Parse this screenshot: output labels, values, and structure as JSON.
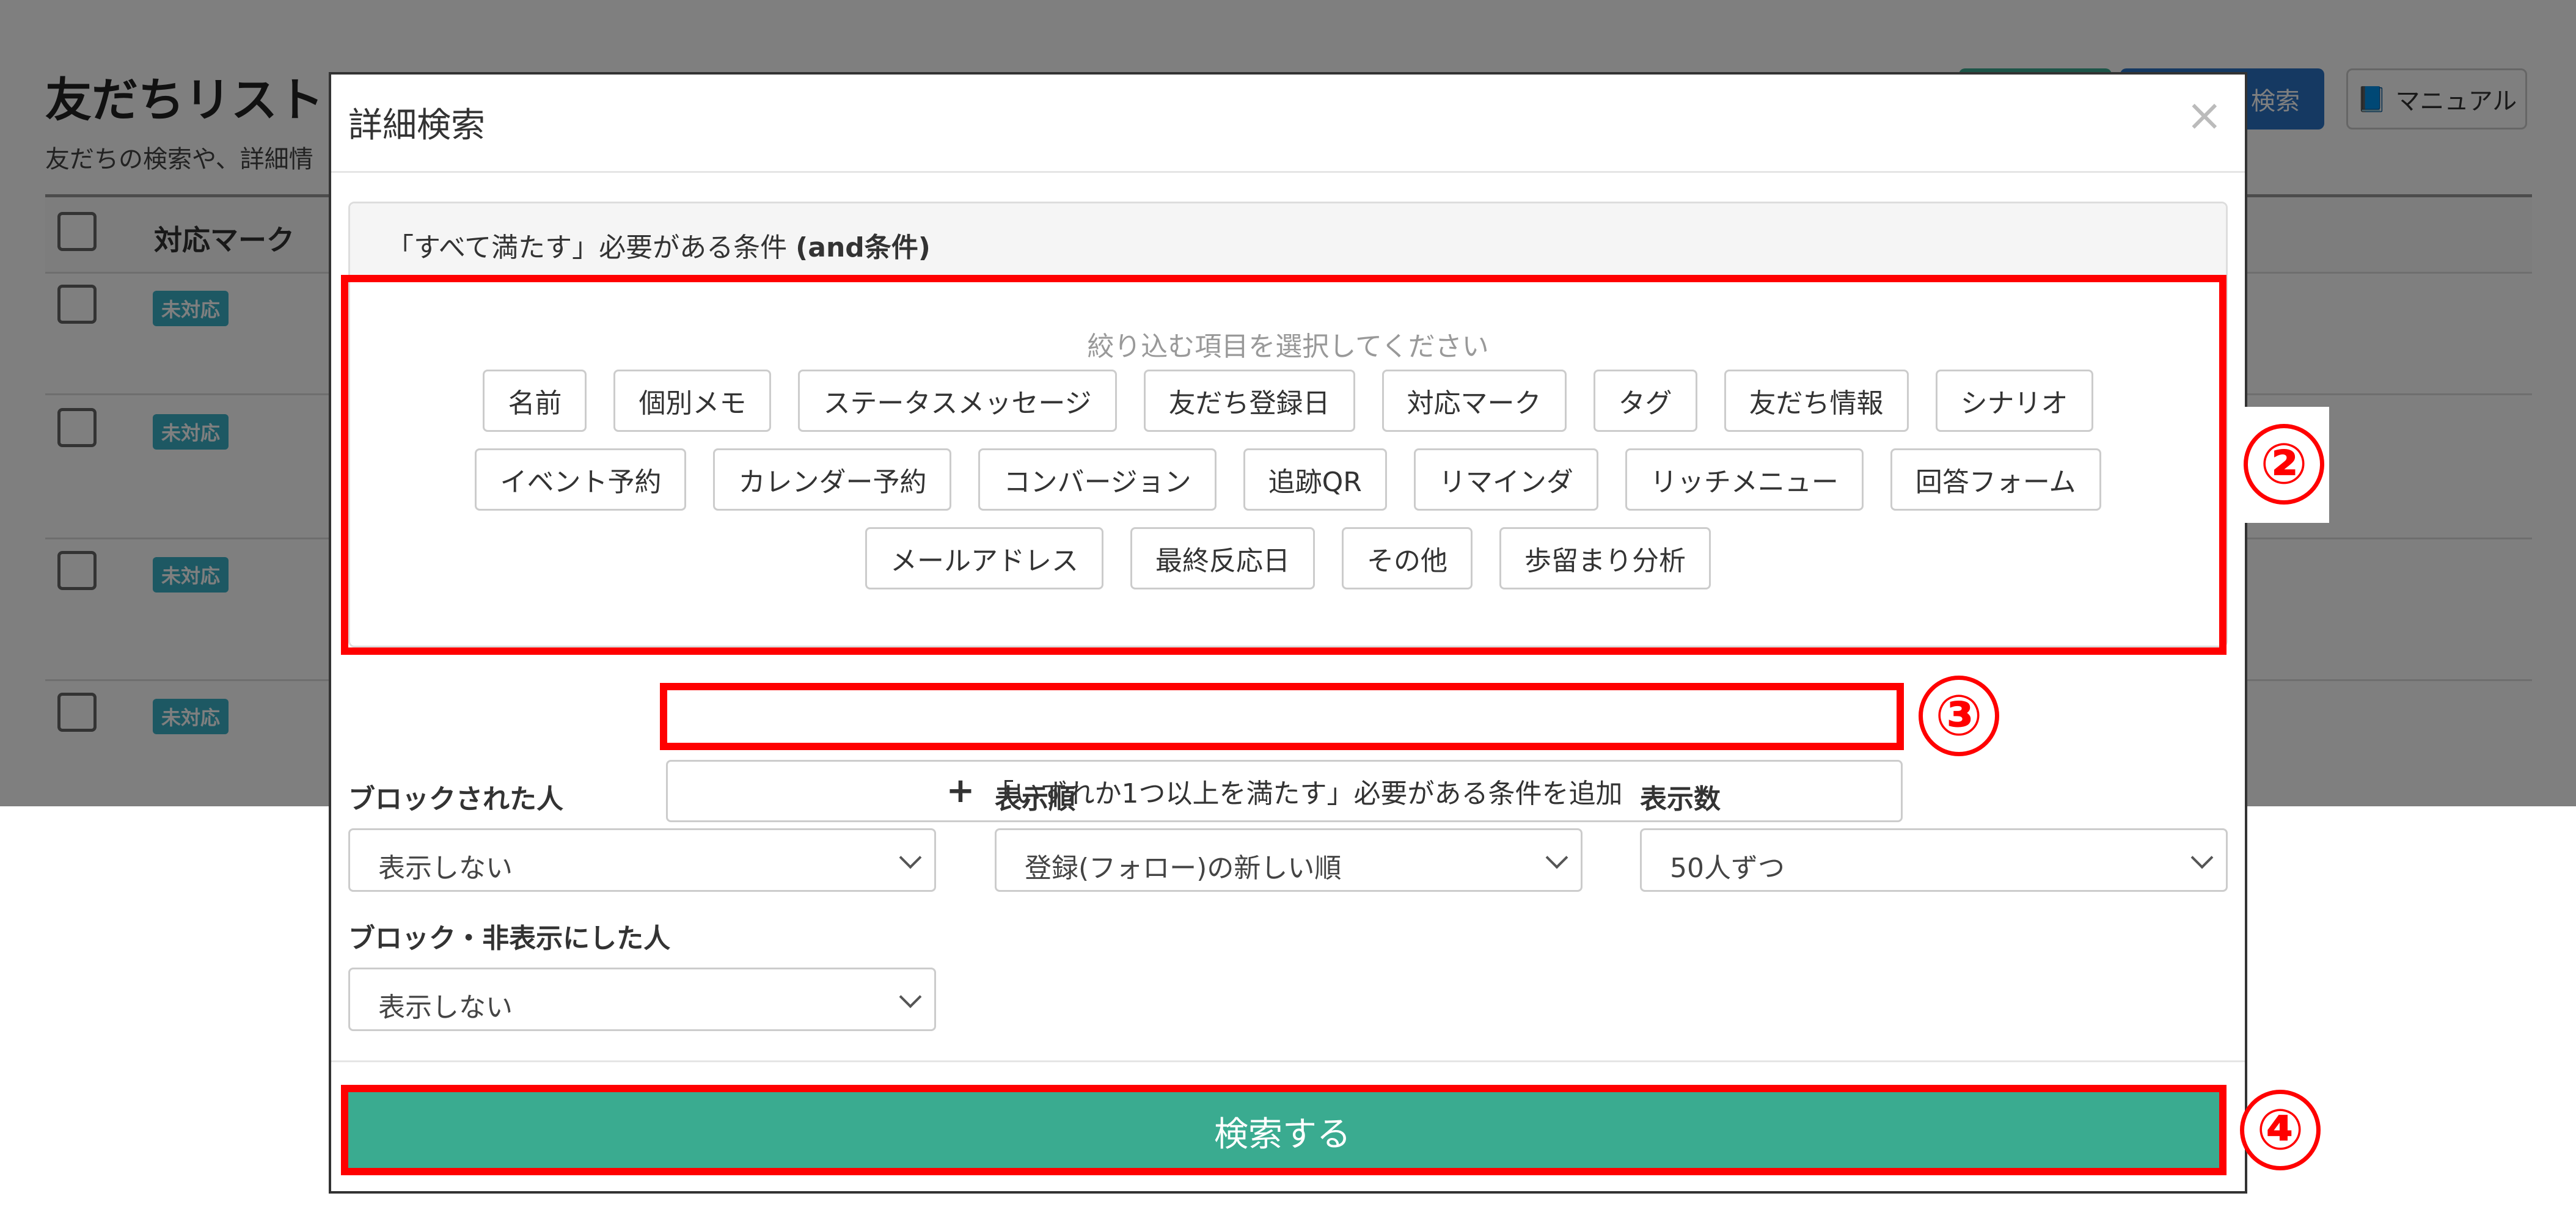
{
  "background_page": {
    "title": "友だちリスト",
    "subtitle": "友だちの検索や、詳細情",
    "search_button_label": "検索",
    "manual_button_label": "マニュアル",
    "table_header_label": "対応マーク",
    "rows": [
      {
        "badge": "未対応"
      },
      {
        "badge": "未対応"
      },
      {
        "badge": "未対応"
      },
      {
        "badge": "未対応"
      }
    ]
  },
  "modal": {
    "title": "詳細検索",
    "close_glyph": "×",
    "and_condition": {
      "label_main": "「すべて満たす」必要がある条件 ",
      "label_bold": "(and条件)",
      "hint": "絞り込む項目を選択してください",
      "chips_row1": [
        "名前",
        "個別メモ",
        "ステータスメッセージ",
        "友だち登録日",
        "対応マーク",
        "タグ",
        "友だち情報",
        "シナリオ"
      ],
      "chips_row2": [
        "イベント予約",
        "カレンダー予約",
        "コンバージョン",
        "追跡QR",
        "リマインダ",
        "リッチメニュー",
        "回答フォーム"
      ],
      "chips_row3": [
        "メールアドレス",
        "最終反応日",
        "その他",
        "歩留まり分析"
      ]
    },
    "or_condition_button": "「いずれか1つ以上を満たす」必要がある条件を追加",
    "filters": {
      "blocked": {
        "label": "ブロックされた人",
        "value": "表示しない"
      },
      "order": {
        "label": "表示順",
        "value": "登録(フォロー)の新しい順"
      },
      "count": {
        "label": "表示数",
        "value": "50人ずつ"
      },
      "blocked_hidden": {
        "label": "ブロック・非表示にした人",
        "value": "表示しない"
      }
    },
    "submit_button": "検索する"
  },
  "annotations": {
    "marker_2": "②",
    "marker_3": "③",
    "marker_4": "④",
    "color": "#ff0000"
  },
  "colors": {
    "primary_green": "#3aab90",
    "primary_blue": "#2a72c4",
    "badge_teal": "#3ab0c7",
    "overlay": "rgba(0,0,0,0.5)"
  }
}
